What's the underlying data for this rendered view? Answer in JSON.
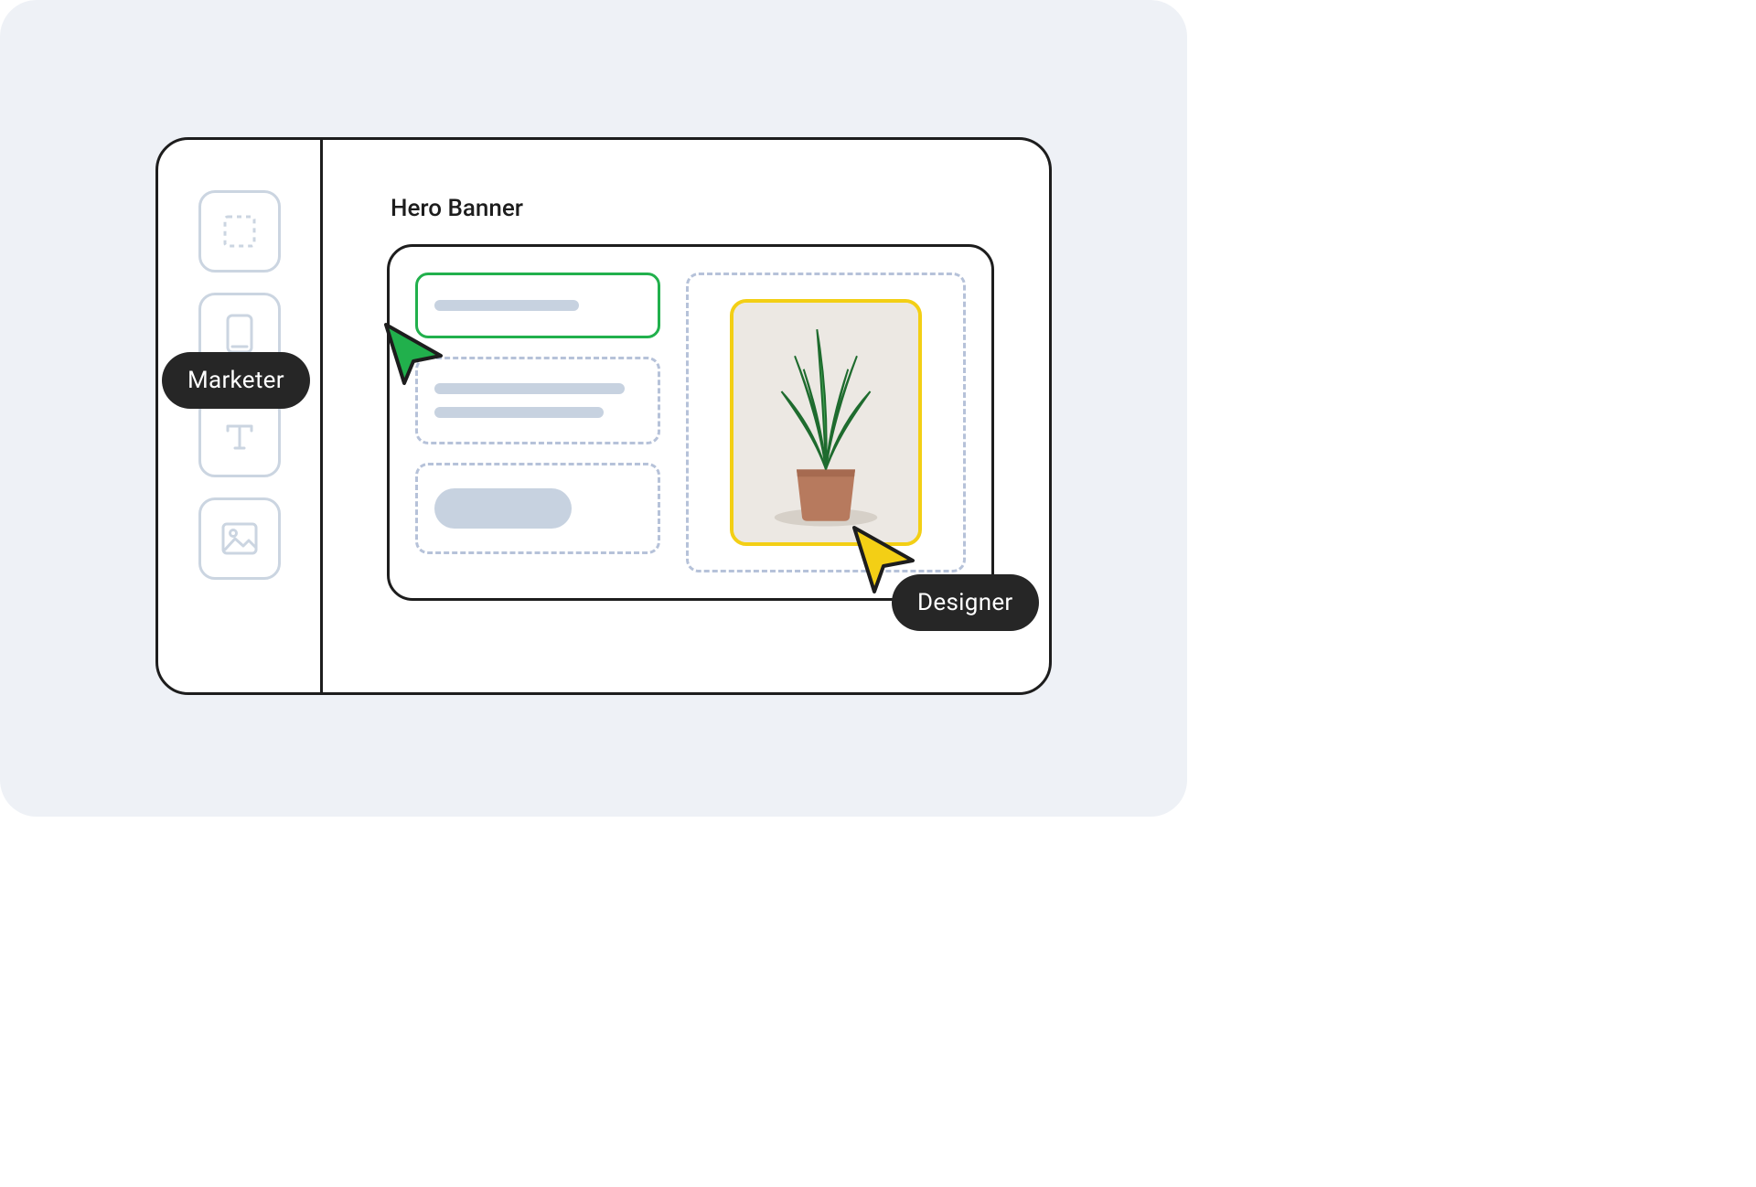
{
  "canvas": {
    "section_title": "Hero Banner"
  },
  "sidebar": {
    "tools": [
      {
        "name": "selection-tool",
        "icon": "dashed-square-icon"
      },
      {
        "name": "device-tool",
        "icon": "rectangle-icon"
      },
      {
        "name": "text-tool",
        "icon": "text-icon",
        "glyph": "T"
      },
      {
        "name": "image-tool",
        "icon": "image-icon"
      }
    ]
  },
  "cursors": {
    "marketer": {
      "label": "Marketer",
      "color": "#21B04C"
    },
    "designer": {
      "label": "Designer",
      "color": "#F3CF15"
    }
  },
  "colors": {
    "page_bg": "#EEF1F6",
    "window_border": "#1D1D1D",
    "sidebar_icon": "#CBD5E1",
    "placeholder_dash": "#B6C2D9",
    "placeholder_fill": "#C7D2E0",
    "marketer_accent": "#21B04C",
    "designer_accent": "#F3CF15",
    "label_bg": "#262626"
  }
}
